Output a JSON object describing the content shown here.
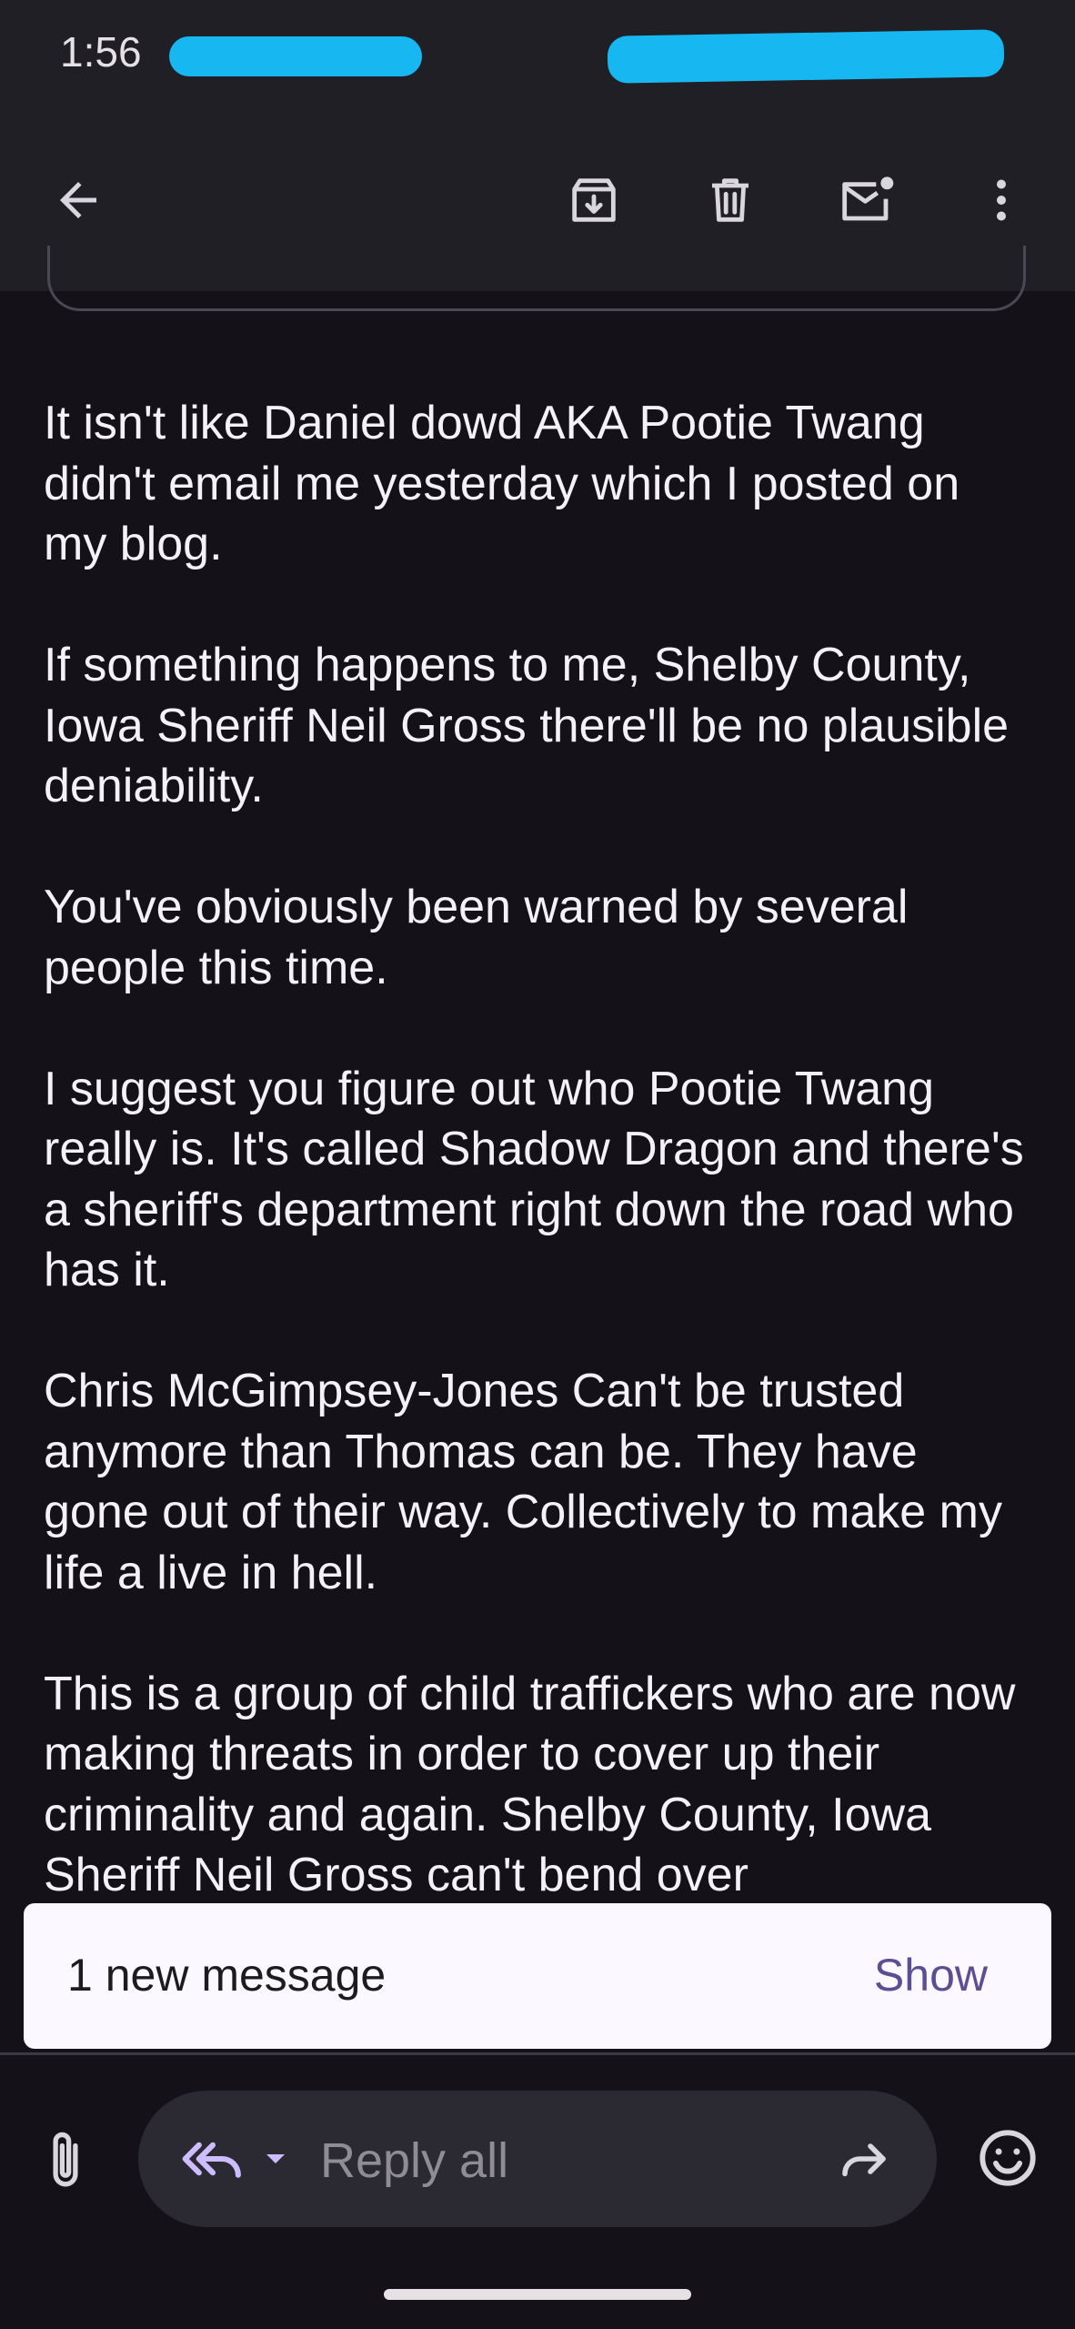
{
  "status_bar": {
    "time": "1:56"
  },
  "app_bar": {
    "icons": [
      "back-arrow-icon",
      "archive-icon",
      "delete-icon",
      "mark-unread-icon",
      "more-vert-icon"
    ]
  },
  "email": {
    "paragraphs": [
      "It isn't like Daniel dowd AKA Pootie Twang didn't email me yesterday which I posted on my blog.",
      "If something happens to me, Shelby County, Iowa Sheriff Neil Gross there'll be no plausible deniability.",
      "You've obviously been warned by several people this time.",
      "I suggest you figure out who Pootie Twang really is. It's called Shadow Dragon and there's a sheriff's department right down the road who has it.",
      "Chris McGimpsey-Jones Can't be trusted anymore than Thomas can be. They have gone out of their way. Collectively to make my life a live in hell.",
      "This is a group of child traffickers who are now making threats in order to cover up their criminality and again. Shelby County, Iowa Sheriff Neil Gross can't bend over"
    ]
  },
  "snackbar": {
    "message": "1 new message",
    "action": "Show"
  },
  "reply_bar": {
    "label": "Reply all"
  },
  "colors": {
    "background": "#141218",
    "toolbar": "#201f25",
    "accent": "#cdbdff",
    "snackbar_action": "#5a4f92",
    "redaction": "#17b7f2"
  }
}
